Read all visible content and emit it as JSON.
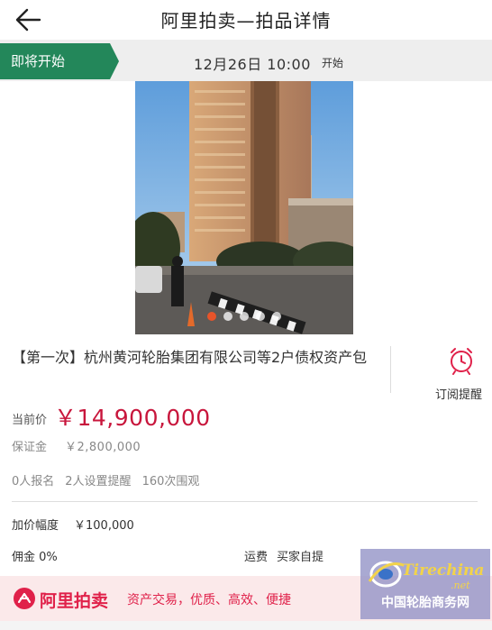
{
  "header": {
    "title": "阿里拍卖—拍品详情"
  },
  "status": {
    "tag": "即将开始",
    "time": "12月26日 10:00",
    "time_suffix": "开始"
  },
  "photo": {
    "dot_count": 5,
    "active_index": 0
  },
  "item": {
    "title": "【第一次】杭州黄河轮胎集团有限公司等2户债权资产包",
    "subscribe_label": "订阅提醒"
  },
  "price": {
    "label": "当前价",
    "value": "￥14,900,000",
    "deposit_label": "保证金",
    "deposit_value": "￥2,800,000"
  },
  "stats": {
    "signups": "0人报名",
    "reminders": "2人设置提醒",
    "views": "160次围观"
  },
  "details": {
    "increment_label": "加价幅度",
    "increment_value": "￥100,000",
    "commission": "佣金 0%",
    "shipping_label": "运费",
    "shipping_value": "买家自提"
  },
  "banner": {
    "brand": "阿里拍卖",
    "tagline": "资产交易，优质、高效、便捷"
  },
  "watermark": {
    "brand": "Tirechina",
    "net": ".net",
    "cn": "中国轮胎商务网"
  },
  "colors": {
    "accent_green": "#23875a",
    "price_red": "#c8163c",
    "brand_red": "#e0214a"
  }
}
